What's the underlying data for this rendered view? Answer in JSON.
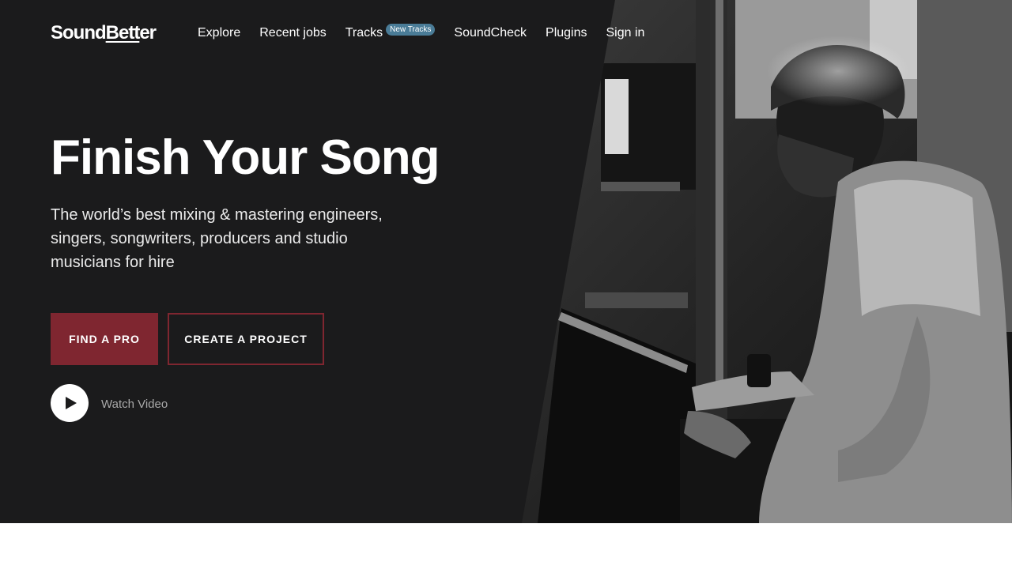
{
  "brand": {
    "logo_prefix": "Sound",
    "logo_underlined": "Bett",
    "logo_suffix": "er"
  },
  "nav": {
    "items": [
      {
        "label": "Explore"
      },
      {
        "label": "Recent jobs"
      },
      {
        "label": "Tracks",
        "badge": "New Tracks"
      },
      {
        "label": "SoundCheck"
      },
      {
        "label": "Plugins"
      },
      {
        "label": "Sign in"
      }
    ]
  },
  "hero": {
    "title": "Finish Your Song",
    "subtitle": "The world’s best mixing & mastering engineers, singers, songwriters, producers and studio musicians for hire",
    "primary_cta": "FIND A PRO",
    "secondary_cta": "CREATE A PROJECT",
    "video_label": "Watch Video",
    "image": "black-and-white-photo-man-playing-piano"
  },
  "colors": {
    "hero_background": "#1b1b1c",
    "accent": "#7f2630",
    "badge": "#4a7c97"
  }
}
